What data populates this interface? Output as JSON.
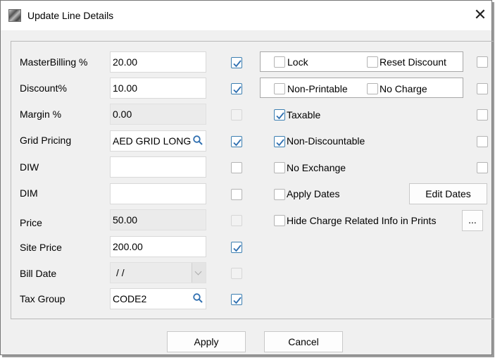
{
  "window": {
    "title": "Update Line Details",
    "close_glyph": "✕"
  },
  "fields": [
    {
      "label": "MasterBilling %",
      "value": "20.00",
      "disabled": false,
      "checked": true,
      "check_dim": false
    },
    {
      "label": "Discount%",
      "value": "10.00",
      "disabled": false,
      "checked": true,
      "check_dim": false
    },
    {
      "label": "Margin %",
      "value": "0.00",
      "disabled": true,
      "checked": false,
      "check_dim": true
    },
    {
      "label": "Grid Pricing",
      "value": "AED GRID LONG",
      "disabled": false,
      "checked": true,
      "check_dim": false,
      "icon": "search-icon"
    },
    {
      "label": "DIW",
      "value": "",
      "disabled": false,
      "checked": false,
      "check_dim": false
    },
    {
      "label": "DIM",
      "value": "",
      "disabled": false,
      "checked": false,
      "check_dim": false
    },
    {
      "label": "Price",
      "value": "50.00",
      "disabled": true,
      "checked": false,
      "check_dim": true
    },
    {
      "label": "Site Price",
      "value": "200.00",
      "disabled": false,
      "checked": true,
      "check_dim": false
    },
    {
      "label": "Bill Date",
      "value": " / /",
      "disabled": true,
      "checked": false,
      "check_dim": true
    },
    {
      "label": "Tax Group",
      "value": "CODE2",
      "disabled": false,
      "checked": true,
      "check_dim": false,
      "icon": "search-icon"
    }
  ],
  "options": {
    "lock": {
      "label": "Lock",
      "checked": false
    },
    "reset_discount": {
      "label": "Reset Discount",
      "checked": false
    },
    "non_printable": {
      "label": "Non-Printable",
      "checked": false
    },
    "no_charge": {
      "label": "No Charge",
      "checked": false
    },
    "taxable": {
      "label": "Taxable",
      "checked": true
    },
    "non_discountable": {
      "label": "Non-Discountable",
      "checked": true
    },
    "no_exchange": {
      "label": "No Exchange",
      "checked": false
    },
    "apply_dates": {
      "label": "Apply Dates",
      "checked": false
    },
    "hide_charge": {
      "label": "Hide Charge Related Info in Prints",
      "checked": false
    }
  },
  "buttons": {
    "edit_dates": "Edit Dates",
    "ellipsis": "...",
    "apply": "Apply",
    "cancel": "Cancel"
  },
  "colors": {
    "check": "#2f6fb0",
    "border": "#b9b9b9"
  }
}
